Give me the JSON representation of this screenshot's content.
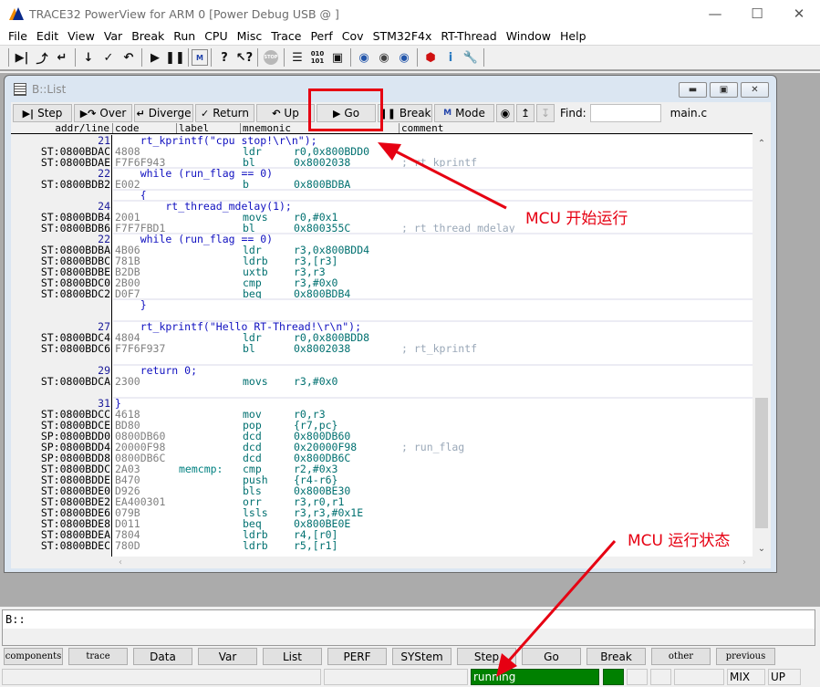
{
  "window": {
    "title": "TRACE32 PowerView for ARM 0 [Power Debug USB @ ]",
    "controls": [
      "minimize",
      "maximize",
      "close"
    ]
  },
  "menu": [
    "File",
    "Edit",
    "View",
    "Var",
    "Break",
    "Run",
    "CPU",
    "Misc",
    "Trace",
    "Perf",
    "Cov",
    "STM32F4x",
    "RT-Thread",
    "Window",
    "Help"
  ],
  "toolbar": {
    "icons": [
      "step-icon",
      "step-over-icon",
      "diverge-icon",
      "down-icon",
      "return-icon",
      "up-icon",
      "go-icon",
      "break-icon",
      "mode-icon",
      "help-icon",
      "context-help-icon",
      "stop-icon",
      "list-icon",
      "dump-icon",
      "register-icon",
      "watch-add-icon",
      "watch-icon",
      "watch-view-icon",
      "rtos-icon",
      "info-icon",
      "settings-icon"
    ],
    "stop_glyph": "STOP"
  },
  "list_window": {
    "title": "B::List",
    "buttons": {
      "step": "Step",
      "over": "Over",
      "diverge": "Diverge",
      "return": "Return",
      "up": "Up",
      "go": "Go",
      "break": "Break",
      "mode": "Mode"
    },
    "find_label": "Find:",
    "find_value": "",
    "file": "main.c",
    "columns": [
      "addr/line",
      "code",
      "label",
      "mnemonic",
      "comment"
    ],
    "rows": [
      {
        "type": "src",
        "line": "21",
        "text": "    rt_kprintf(\"cpu stop!\\r\\n\");"
      },
      {
        "type": "asm",
        "addr": "ST:0800BDAC",
        "code": "4808",
        "label": "",
        "mnem": "ldr",
        "oper": "r0,0x800BDD0",
        "comment": ""
      },
      {
        "type": "asm",
        "addr": "ST:0800BDAE",
        "code": "F7F6F943",
        "label": "",
        "mnem": "bl",
        "oper": "0x8002038",
        "comment": "; rt_kprintf"
      },
      {
        "type": "src",
        "line": "22",
        "text": "    while (run_flag == 0)"
      },
      {
        "type": "asm",
        "addr": "ST:0800BDB2",
        "code": "E002",
        "label": "",
        "mnem": "b",
        "oper": "0x800BDBA",
        "comment": ""
      },
      {
        "type": "src",
        "line": "",
        "text": "    {"
      },
      {
        "type": "src",
        "line": "24",
        "text": "        rt_thread_mdelay(1);"
      },
      {
        "type": "asm",
        "addr": "ST:0800BDB4",
        "code": "2001",
        "label": "",
        "mnem": "movs",
        "oper": "r0,#0x1",
        "comment": ""
      },
      {
        "type": "asm",
        "addr": "ST:0800BDB6",
        "code": "F7F7FBD1",
        "label": "",
        "mnem": "bl",
        "oper": "0x800355C",
        "comment": "; rt_thread_mdelay"
      },
      {
        "type": "src",
        "line": "22",
        "text": "    while (run_flag == 0)"
      },
      {
        "type": "asm",
        "addr": "ST:0800BDBA",
        "code": "4B06",
        "label": "",
        "mnem": "ldr",
        "oper": "r3,0x800BDD4",
        "comment": ""
      },
      {
        "type": "asm",
        "addr": "ST:0800BDBC",
        "code": "781B",
        "label": "",
        "mnem": "ldrb",
        "oper": "r3,[r3]",
        "comment": ""
      },
      {
        "type": "asm",
        "addr": "ST:0800BDBE",
        "code": "B2DB",
        "label": "",
        "mnem": "uxtb",
        "oper": "r3,r3",
        "comment": ""
      },
      {
        "type": "asm",
        "addr": "ST:0800BDC0",
        "code": "2B00",
        "label": "",
        "mnem": "cmp",
        "oper": "r3,#0x0",
        "comment": ""
      },
      {
        "type": "asm",
        "addr": "ST:0800BDC2",
        "code": "D0F7",
        "label": "",
        "mnem": "beq",
        "oper": "0x800BDB4",
        "comment": ""
      },
      {
        "type": "src",
        "line": "",
        "text": "    }"
      },
      {
        "type": "blank"
      },
      {
        "type": "src",
        "line": "27",
        "text": "    rt_kprintf(\"Hello RT-Thread!\\r\\n\");"
      },
      {
        "type": "asm",
        "addr": "ST:0800BDC4",
        "code": "4804",
        "label": "",
        "mnem": "ldr",
        "oper": "r0,0x800BDD8",
        "comment": ""
      },
      {
        "type": "asm",
        "addr": "ST:0800BDC6",
        "code": "F7F6F937",
        "label": "",
        "mnem": "bl",
        "oper": "0x8002038",
        "comment": "; rt_kprintf"
      },
      {
        "type": "blank"
      },
      {
        "type": "src",
        "line": "29",
        "text": "    return 0;"
      },
      {
        "type": "asm",
        "addr": "ST:0800BDCA",
        "code": "2300",
        "label": "",
        "mnem": "movs",
        "oper": "r3,#0x0",
        "comment": ""
      },
      {
        "type": "blank"
      },
      {
        "type": "src",
        "line": "31",
        "text": "}"
      },
      {
        "type": "asm",
        "addr": "ST:0800BDCC",
        "code": "4618",
        "label": "",
        "mnem": "mov",
        "oper": "r0,r3",
        "comment": ""
      },
      {
        "type": "asm",
        "addr": "ST:0800BDCE",
        "code": "BD80",
        "label": "",
        "mnem": "pop",
        "oper": "{r7,pc}",
        "comment": ""
      },
      {
        "type": "asm",
        "addr": "SP:0800BDD0",
        "code": "0800DB60",
        "label": "",
        "mnem": "dcd",
        "oper": "0x800DB60",
        "comment": ""
      },
      {
        "type": "asm",
        "addr": "SP:0800BDD4",
        "code": "20000F98",
        "label": "",
        "mnem": "dcd",
        "oper": "0x20000F98",
        "comment": "; run_flag"
      },
      {
        "type": "asm",
        "addr": "SP:0800BDD8",
        "code": "0800DB6C",
        "label": "",
        "mnem": "dcd",
        "oper": "0x800DB6C",
        "comment": ""
      },
      {
        "type": "asm",
        "addr": "ST:0800BDDC",
        "code": "2A03",
        "label": "memcmp:",
        "mnem": "cmp",
        "oper": "r2,#0x3",
        "comment": ""
      },
      {
        "type": "asm",
        "addr": "ST:0800BDDE",
        "code": "B470",
        "label": "",
        "mnem": "push",
        "oper": "{r4-r6}",
        "comment": ""
      },
      {
        "type": "asm",
        "addr": "ST:0800BDE0",
        "code": "D926",
        "label": "",
        "mnem": "bls",
        "oper": "0x800BE30",
        "comment": ""
      },
      {
        "type": "asm",
        "addr": "ST:0800BDE2",
        "code": "EA400301",
        "label": "",
        "mnem": "orr",
        "oper": "r3,r0,r1",
        "comment": ""
      },
      {
        "type": "asm",
        "addr": "ST:0800BDE6",
        "code": "079B",
        "label": "",
        "mnem": "lsls",
        "oper": "r3,r3,#0x1E",
        "comment": ""
      },
      {
        "type": "asm",
        "addr": "ST:0800BDE8",
        "code": "D011",
        "label": "",
        "mnem": "beq",
        "oper": "0x800BE0E",
        "comment": ""
      },
      {
        "type": "asm",
        "addr": "ST:0800BDEA",
        "code": "7804",
        "label": "",
        "mnem": "ldrb",
        "oper": "r4,[r0]",
        "comment": ""
      },
      {
        "type": "asm",
        "addr": "ST:0800BDEC",
        "code": "780D",
        "label": "",
        "mnem": "ldrb",
        "oper": "r5,[r1]",
        "comment": ""
      }
    ],
    "vertical_scroll_position": 0.7
  },
  "command_line": {
    "prompt": "B::",
    "value": ""
  },
  "softkeys": [
    "components",
    "trace",
    "Data",
    "Var",
    "List",
    "PERF",
    "SYStem",
    "Step",
    "Go",
    "Break",
    "other",
    "previous"
  ],
  "status_bar": {
    "state": "running",
    "mode": "MIX",
    "direction": "UP",
    "state_color": "#008000"
  },
  "annotations": {
    "go_label": "MCU 开始运行",
    "status_label": "MCU 运行状态",
    "color": "#e60012"
  }
}
